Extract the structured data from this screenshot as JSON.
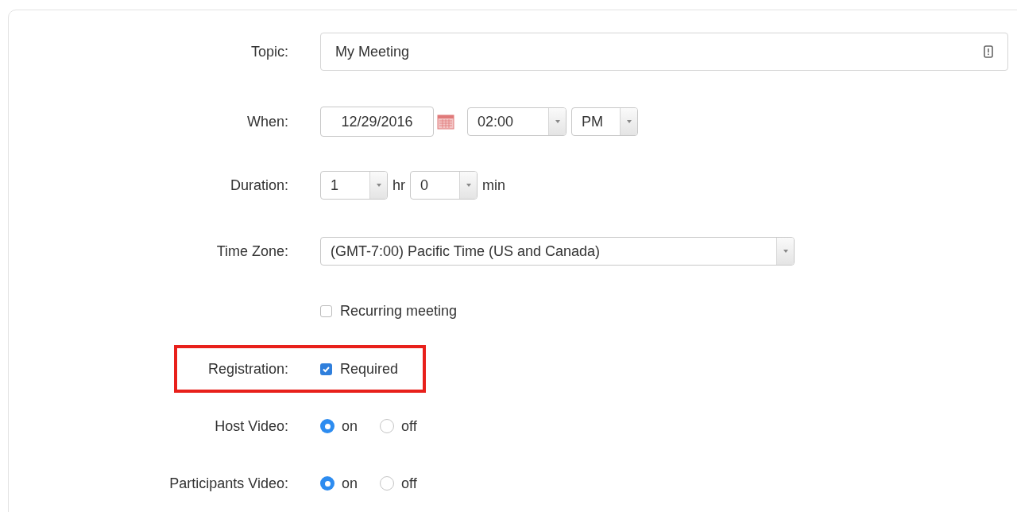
{
  "topic": {
    "label": "Topic:",
    "value": "My Meeting"
  },
  "when": {
    "label": "When:",
    "date": "12/29/2016",
    "time": "02:00",
    "period": "PM"
  },
  "duration": {
    "label": "Duration:",
    "hours": "1",
    "hours_unit": "hr",
    "minutes": "0",
    "minutes_unit": "min"
  },
  "time_zone": {
    "label": "Time Zone:",
    "value": "(GMT-7:00) Pacific Time (US and Canada)"
  },
  "recurring": {
    "label": "Recurring meeting",
    "checked": false
  },
  "registration": {
    "label": "Registration:",
    "option": "Required",
    "checked": true,
    "highlighted": true
  },
  "video_options": [
    {
      "label": "Host Video:",
      "options": [
        {
          "label": "on",
          "selected": true
        },
        {
          "label": "off",
          "selected": false
        }
      ]
    },
    {
      "label": "Participants Video:",
      "options": [
        {
          "label": "on",
          "selected": true
        },
        {
          "label": "off",
          "selected": false
        }
      ]
    }
  ]
}
